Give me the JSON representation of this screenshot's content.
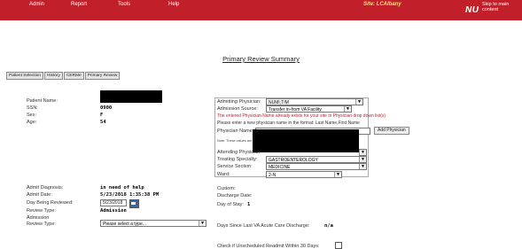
{
  "topbar": {
    "menu": [
      "Admin",
      "Report",
      "Tools",
      "Help"
    ],
    "site": "Site: LCAlbany",
    "logo": "NUMI",
    "skip": "Skip to main content"
  },
  "page_title": "Primary Review Summary",
  "tabs": [
    "Patient Selection",
    "History",
    "CERMe",
    "Primary Review"
  ],
  "patient": {
    "name_label": "Patient Name:",
    "ssn_label": "SSN:",
    "ssn_value": "0900",
    "sex_label": "Sex:",
    "sex_value": "F",
    "age_label": "Age:",
    "age_value": "54"
  },
  "admission": {
    "diag_label": "Admit Diagnosis:",
    "diag_value": "in need of help",
    "date_label": "Admit Date:",
    "date_value": "5/23/2018 1:35:38 PM",
    "day_label": "Day Being Reviewed:",
    "day_value": "5/23/2018",
    "review_type_label": "Review Type:",
    "review_type_value": "Admission",
    "adm_review_label_1": "Admission",
    "adm_review_label_2": "Review Type:",
    "adm_review_select": "Please select a type..."
  },
  "physician": {
    "admitting_label": "Admitting Physician:",
    "admitting_value": "NUMI,TIM",
    "source_label": "Admission Source:",
    "source_value": "Transfer in-from VA Facility",
    "warning": "The entered Physician Name already exists for your site in Physician drop down list(s)",
    "hint": "Please enter a new physician name in the format: Last Name,First Name",
    "name_label": "Physician Name:",
    "add_button": "Add Physician",
    "note": "Note: These values are as",
    "attending_label": "Attending Physician:",
    "specialty_label": "Treating Specialty:",
    "specialty_value": "GASTROENTEROLOGY",
    "service_label": "Service Section:",
    "service_value": "MEDICINE",
    "ward_label": "Ward:",
    "ward_value": "2-N",
    "custom_label": "Custom:",
    "discharge_label": "Discharge Date:",
    "day_of_stay_label": "Day of Stay:",
    "day_of_stay_value": "1"
  },
  "bottom": {
    "days_since_label": "Days Since Last VA Acute Care Discharge:",
    "days_since_value": "n/a",
    "unscheduled_label": "Check if Unscheduled Readmit Within 30 Days:"
  }
}
